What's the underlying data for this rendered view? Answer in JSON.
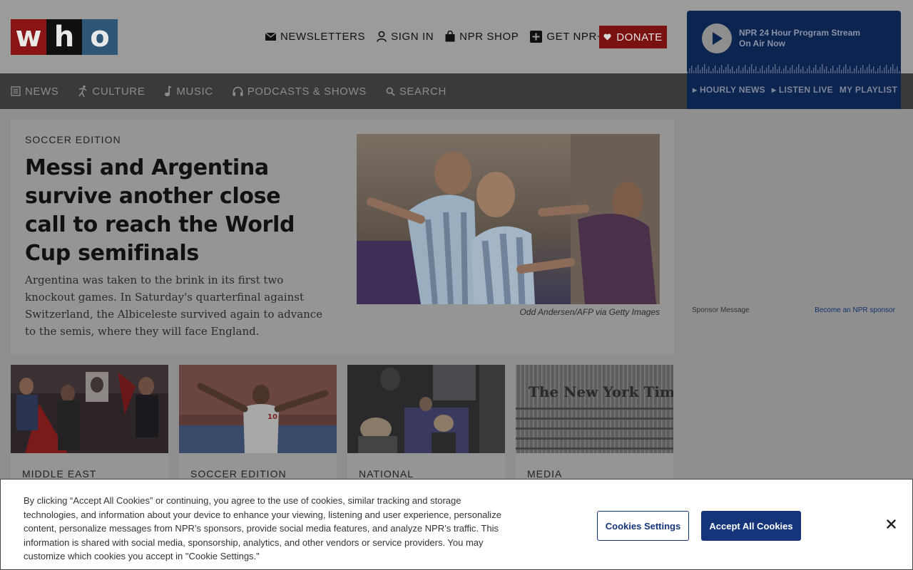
{
  "header": {
    "logo_letters": [
      "w",
      "h",
      "o"
    ],
    "nav": [
      {
        "label": "NEWSLETTERS",
        "icon": "envelope-icon"
      },
      {
        "label": "SIGN IN",
        "icon": "user-icon"
      },
      {
        "label": "NPR SHOP",
        "icon": "shopping-bag-icon"
      },
      {
        "label": "GET NPR+",
        "icon": "plus-square-icon"
      }
    ],
    "donate": {
      "label": "DONATE",
      "icon": "heart-icon"
    }
  },
  "player": {
    "title": "NPR 24 Hour Program Stream",
    "subtitle": "On Air Now",
    "links": [
      "▸ HOURLY NEWS",
      "▸ LISTEN LIVE",
      "MY PLAYLIST"
    ]
  },
  "section_nav": [
    {
      "label": "NEWS",
      "icon": "newspaper-icon"
    },
    {
      "label": "CULTURE",
      "icon": "dancer-icon"
    },
    {
      "label": "MUSIC",
      "icon": "music-note-icon"
    },
    {
      "label": "PODCASTS & SHOWS",
      "icon": "headphones-icon"
    },
    {
      "label": "SEARCH",
      "icon": "search-icon"
    }
  ],
  "hero": {
    "label": "SOCCER EDITION",
    "title": "Messi and Argentina survive another close call to reach the World Cup semifinals",
    "teaser": "Argentina was taken to the brink in its first two knockout games. In Saturday's quarterfinal against Switzerland, the Albiceleste survived again to advance to the semis, where they will face England.",
    "credit": "Odd Andersen/AFP via Getty Images"
  },
  "cards": [
    {
      "label": "MIDDLE EAST"
    },
    {
      "label": "SOCCER EDITION"
    },
    {
      "label": "NATIONAL"
    },
    {
      "label": "MEDIA"
    }
  ],
  "card_image_texts": {
    "nyt_masthead": "The New York Times"
  },
  "sponsor": {
    "message": "Sponsor Message",
    "link": "Become an NPR sponsor"
  },
  "cookie": {
    "text": "By clicking “Accept All Cookies” or continuing, you agree to the use of cookies, similar tracking and storage technologies, and information about your device to enhance your viewing, listening and user experience, personalize content, personalize messages from NPR’s sponsors, provide social media features, and analyze NPR’s traffic. This information is shared with social media, sponsorship, analytics, and other vendors or service providers. You may customize which cookies you accept in \"Cookie Settings.\"",
    "settings_label": "Cookies Settings",
    "accept_label": "Accept All Cookies",
    "close_icon": "close-icon"
  },
  "colors": {
    "donate_red": "#7a1212",
    "player_navy": "#0c2450",
    "cookie_button_blue": "#15357b",
    "nav_dark": "#3a3a3a"
  }
}
